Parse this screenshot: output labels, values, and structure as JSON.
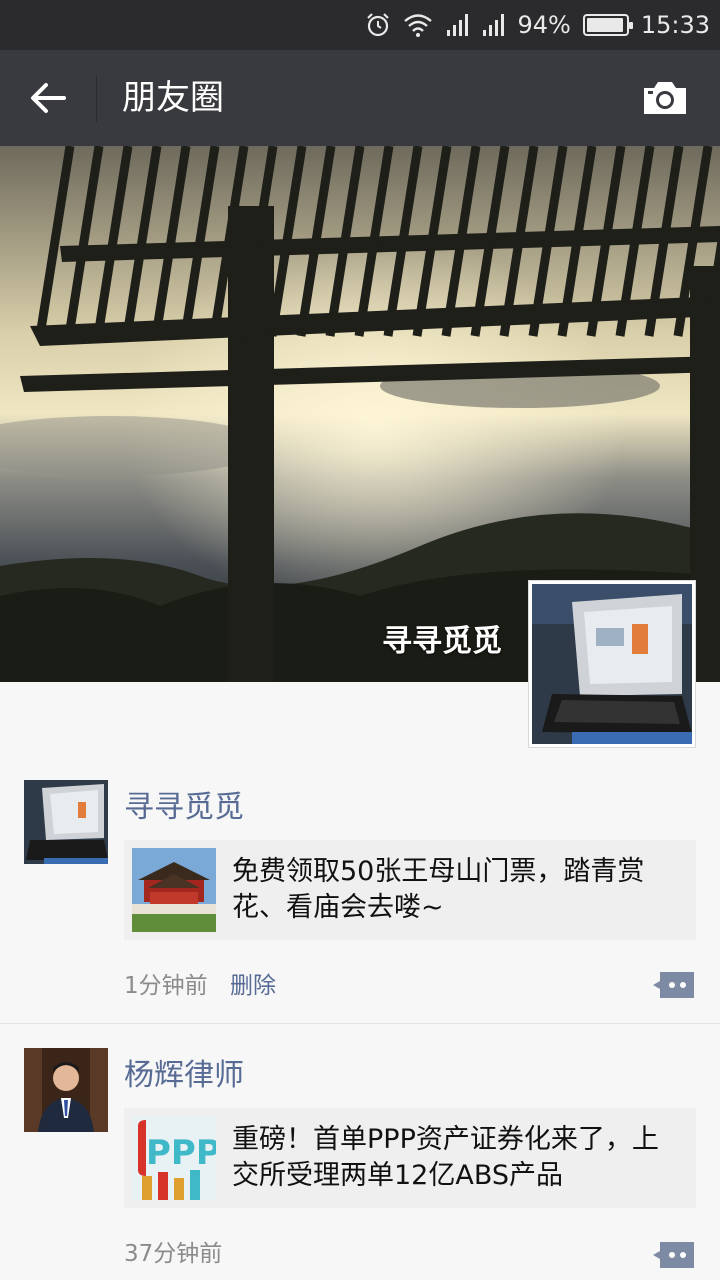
{
  "status_bar": {
    "battery_percent_label": "94%",
    "battery_level": 0.94,
    "time": "15:33",
    "icons": [
      "alarm-icon",
      "wifi-icon",
      "signal-icon",
      "signal-icon",
      "battery-icon"
    ]
  },
  "titlebar": {
    "back_icon": "arrow-left-icon",
    "title": "朋友圈",
    "camera_icon": "camera-icon"
  },
  "cover": {
    "user_name": "寻寻觅觅"
  },
  "posts": [
    {
      "author": "寻寻觅觅",
      "link_title": "免费领取50张王母山门票，踏青赏花、看庙会去喽~",
      "time": "1分钟前",
      "delete_label": "删除"
    },
    {
      "author": "杨辉律师",
      "link_title": "重磅！首单PPP资产证券化来了，上交所受理两单12亿ABS产品",
      "time": "37分钟前"
    }
  ],
  "colors": {
    "titlebar_bg": "#393a3f",
    "statusbar_bg": "#2b2b2d",
    "name_link": "#576b95",
    "feed_bg": "#f7f7f7",
    "card_bg": "#efefef"
  }
}
